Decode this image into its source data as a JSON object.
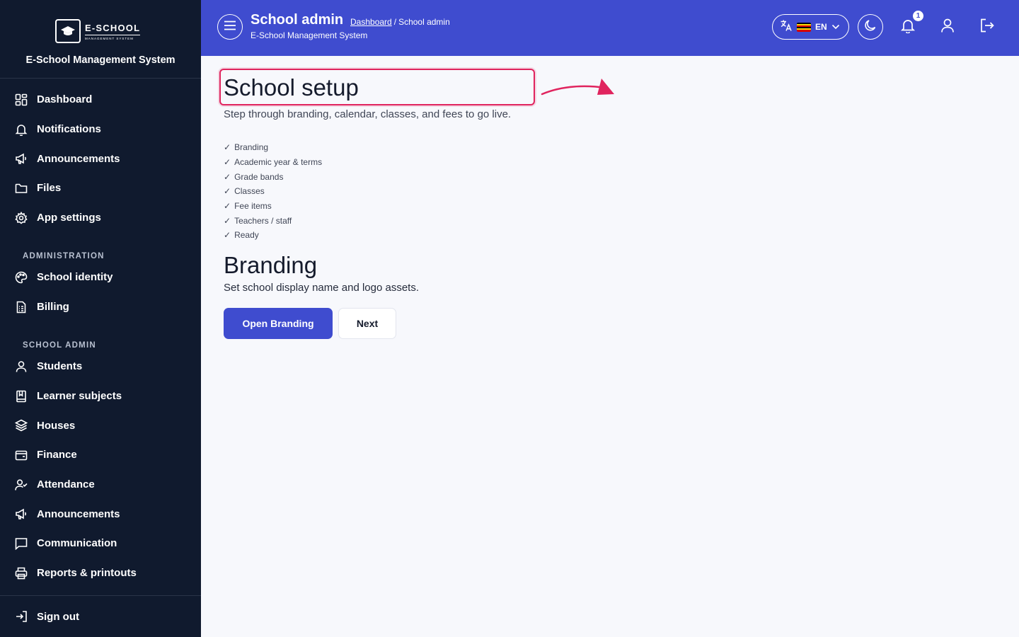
{
  "sidebar": {
    "logo_main": "E-SCHOOL",
    "logo_sub": "MANAGEMENT SYSTEM",
    "brand_title": "E-School Management System",
    "general_items": [
      {
        "label": "Dashboard",
        "icon": "grid-icon"
      },
      {
        "label": "Notifications",
        "icon": "bell-icon"
      },
      {
        "label": "Announcements",
        "icon": "megaphone-icon"
      },
      {
        "label": "Files",
        "icon": "folder-icon"
      },
      {
        "label": "App settings",
        "icon": "gear-icon"
      }
    ],
    "administration_label": "ADMINISTRATION",
    "administration_items": [
      {
        "label": "School identity",
        "icon": "palette-icon"
      },
      {
        "label": "Billing",
        "icon": "invoice-icon"
      }
    ],
    "school_admin_label": "SCHOOL ADMIN",
    "school_admin_items": [
      {
        "label": "Students",
        "icon": "user-icon"
      },
      {
        "label": "Learner subjects",
        "icon": "book-icon"
      },
      {
        "label": "Houses",
        "icon": "layers-icon"
      },
      {
        "label": "Finance",
        "icon": "wallet-icon"
      },
      {
        "label": "Attendance",
        "icon": "user-check-icon"
      },
      {
        "label": "Announcements",
        "icon": "megaphone-icon"
      },
      {
        "label": "Communication",
        "icon": "chat-icon"
      },
      {
        "label": "Reports & printouts",
        "icon": "printer-icon"
      }
    ],
    "sign_out": "Sign out"
  },
  "header": {
    "title": "School admin",
    "breadcrumb_link": "Dashboard",
    "breadcrumb_sep": "/",
    "breadcrumb_current": "School admin",
    "subtitle": "E-School Management System",
    "language_code": "EN",
    "notification_count": "1",
    "accent_color": "#3f4ccf"
  },
  "main": {
    "page_title": "School setup",
    "page_description": "Step through branding, calendar, classes, and fees to go live.",
    "steps": [
      "Branding",
      "Academic year & terms",
      "Grade bands",
      "Classes",
      "Fee items",
      "Teachers / staff",
      "Ready"
    ],
    "step_check": "✓",
    "section_title": "Branding",
    "section_description": "Set school display name and logo assets.",
    "primary_button": "Open Branding",
    "secondary_button": "Next",
    "highlight_color": "#e0245e"
  }
}
